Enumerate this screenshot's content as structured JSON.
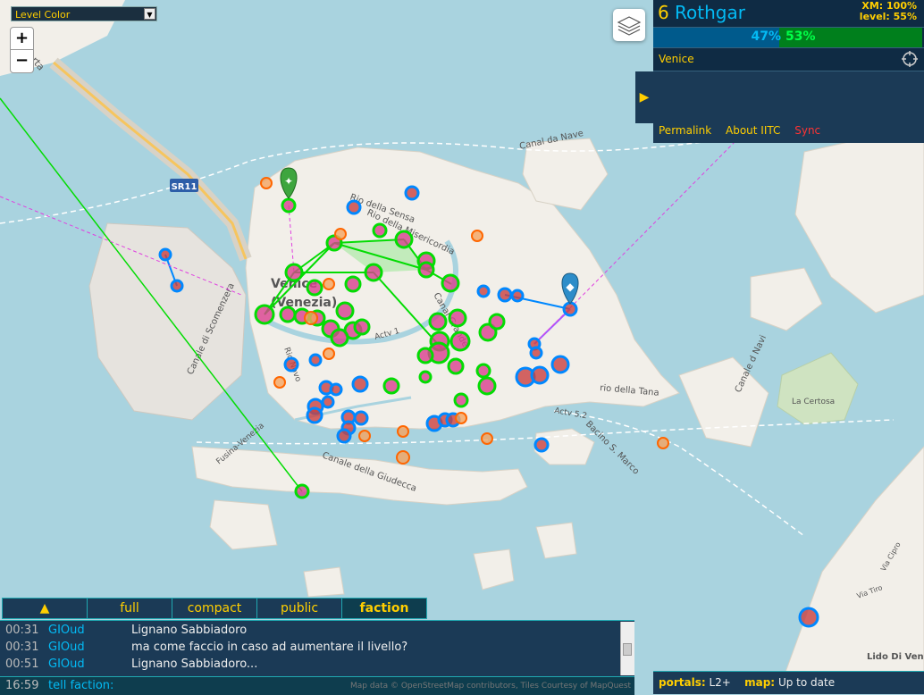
{
  "level_select": {
    "selected": "Level Color"
  },
  "zoom": {
    "in_label": "+",
    "out_label": "−"
  },
  "map_labels": {
    "venice": "Venice",
    "venezia": "(Venezia)",
    "sr11": "SR11",
    "canal_da_nave": "Canal da Nave",
    "la_certosa": "La Certosa",
    "lido": "Lido Di Vene",
    "rio_della_sensa": "Rio della Sensa",
    "rio_della_misericordia": "Rio della Misericordia",
    "canal_della_giudecca": "Canale della Giudecca",
    "bacino": "Bacino S. Marco",
    "rio_della_tana": "rio della Tana",
    "canale_di_scomenzera": "Canale di Scomenzera",
    "liberta": "Liberta",
    "canale_navi": "Canale d Navi",
    "canal_grande": "Canal Grande",
    "rio_novo": "Rio Novo",
    "actv": "Actv 1",
    "actv_52": "Actv 5.2",
    "fusina": "Fusina-Venezia",
    "via_tiro": "Via Tiro",
    "via_cipro": "Via Cipro"
  },
  "player": {
    "level": "6",
    "name": "Rothgar",
    "xm": "XM: 100%",
    "ap_level": "level: 55%"
  },
  "score": {
    "resistance": "47%",
    "enlightened": "53%",
    "resistance_fraction": 0.47
  },
  "location": {
    "name": "Venice"
  },
  "links": {
    "permalink": "Permalink",
    "about": "About IITC",
    "sync": "Sync"
  },
  "chat": {
    "tabs": {
      "full": "full",
      "compact": "compact",
      "public": "public",
      "faction": "faction"
    },
    "messages": [
      {
        "time": "00:31",
        "nick": "GIOud",
        "text": "Lignano Sabbiadoro"
      },
      {
        "time": "00:31",
        "nick": "GIOud",
        "text": "ma come faccio in caso ad aumentare il livello?"
      },
      {
        "time": "00:51",
        "nick": "GIOud",
        "text": "Lignano Sabbiadoro..."
      }
    ],
    "input_time": "16:59",
    "input_prompt": "tell faction:"
  },
  "attribution": "Map data © OpenStreetMap contributors, Tiles Courtesy of MapQuest",
  "status": {
    "portals_label": "portals:",
    "portals_value": "L2+",
    "map_label": "map:",
    "map_value": "Up to date"
  },
  "colors": {
    "enlightened": "#03dc03",
    "resistance": "#0088ff",
    "neutral": "#ff6600",
    "sidebar": "#1b3a56",
    "accent": "#ffce00"
  },
  "icons": {
    "layers": "layers-icon",
    "target": "crosshair-icon",
    "toggle": "chevron-right-icon",
    "chat_expand": "chevron-up-icon"
  }
}
